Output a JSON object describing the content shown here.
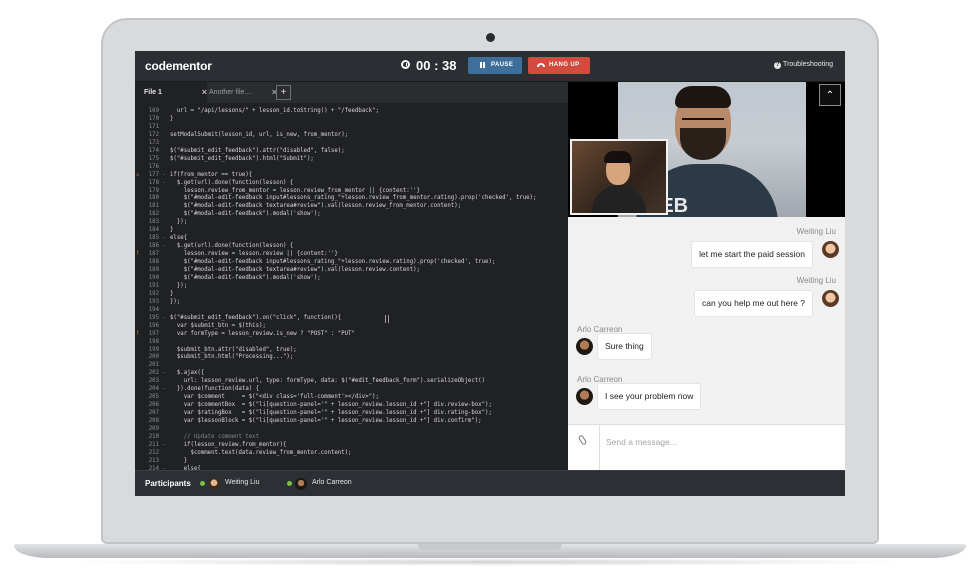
{
  "app": {
    "logo": "codementor",
    "timer": "00 : 38",
    "pause_label": "PAUSE",
    "hangup_label": "HANG UP",
    "troubleshooting_label": "Troubleshooting"
  },
  "tabs": [
    {
      "label": "File 1",
      "close": "×"
    },
    {
      "label": "Another file....",
      "close": "×"
    }
  ],
  "add_tab": "+",
  "editor": {
    "lines": [
      {
        "n": "169",
        "fold": "",
        "mark": "",
        "text": "  url = \"/api/lessons/\" + lesson_id.toString() + \"/feedback\";"
      },
      {
        "n": "170",
        "fold": "",
        "mark": "",
        "text": "}"
      },
      {
        "n": "171",
        "fold": "",
        "mark": "",
        "text": ""
      },
      {
        "n": "172",
        "fold": "",
        "mark": "",
        "text": "setModalSubmit(lesson_id, url, is_new, from_mentor);"
      },
      {
        "n": "173",
        "fold": "",
        "mark": "",
        "text": ""
      },
      {
        "n": "174",
        "fold": "",
        "mark": "",
        "text": "$(\"#submit_edit_feedback\").attr(\"disabled\", false);"
      },
      {
        "n": "175",
        "fold": "",
        "mark": "",
        "text": "$(\"#submit_edit_feedback\").html(\"Submit\");"
      },
      {
        "n": "176",
        "fold": "",
        "mark": "",
        "text": ""
      },
      {
        "n": "177",
        "fold": "-",
        "mark": "⚠",
        "text": "if(from_mentor == true){"
      },
      {
        "n": "178",
        "fold": "-",
        "mark": "",
        "text": "  $.get(url).done(function(lesson) {"
      },
      {
        "n": "179",
        "fold": "",
        "mark": "",
        "text": "    lesson.review_from_mentor = lesson.review_from_mentor || {content:''}"
      },
      {
        "n": "180",
        "fold": "",
        "mark": "",
        "text": "    $(\"#modal-edit-feedback input#lessons_rating_\"+lesson.review_from_mentor.rating).prop('checked', true);"
      },
      {
        "n": "181",
        "fold": "",
        "mark": "",
        "text": "    $(\"#modal-edit-feedback textarea#review\").val(lesson.review_from_mentor.content);"
      },
      {
        "n": "182",
        "fold": "",
        "mark": "",
        "text": "    $(\"#modal-edit-feedback\").modal('show');"
      },
      {
        "n": "183",
        "fold": "",
        "mark": "",
        "text": "  });"
      },
      {
        "n": "184",
        "fold": "",
        "mark": "",
        "text": "}"
      },
      {
        "n": "185",
        "fold": "-",
        "mark": "",
        "text": "else{"
      },
      {
        "n": "186",
        "fold": "-",
        "mark": "",
        "text": "  $.get(url).done(function(lesson) {"
      },
      {
        "n": "187",
        "fold": "",
        "mark": "!",
        "text": "    lesson.review = lesson.review || {content:''}"
      },
      {
        "n": "188",
        "fold": "",
        "mark": "",
        "text": "    $(\"#modal-edit-feedback input#lessons_rating_\"+lesson.review.rating).prop('checked', true);"
      },
      {
        "n": "189",
        "fold": "",
        "mark": "",
        "text": "    $(\"#modal-edit-feedback textarea#review\").val(lesson.review.content);"
      },
      {
        "n": "190",
        "fold": "",
        "mark": "",
        "text": "    $(\"#modal-edit-feedback\").modal('show');"
      },
      {
        "n": "191",
        "fold": "",
        "mark": "",
        "text": "  });"
      },
      {
        "n": "192",
        "fold": "",
        "mark": "",
        "text": "}"
      },
      {
        "n": "193",
        "fold": "",
        "mark": "",
        "text": "});"
      },
      {
        "n": "194",
        "fold": "",
        "mark": "",
        "text": ""
      },
      {
        "n": "195",
        "fold": "-",
        "mark": "",
        "text": "$(\"#submit_edit_feedback\").on(\"click\", function(){"
      },
      {
        "n": "196",
        "fold": "",
        "mark": "",
        "text": "  var $submit_btn = $(this);"
      },
      {
        "n": "197",
        "fold": "",
        "mark": "!",
        "text": "  var formType = lesson_review.is_new ? \"POST\" : \"PUT\""
      },
      {
        "n": "198",
        "fold": "",
        "mark": "",
        "text": ""
      },
      {
        "n": "199",
        "fold": "",
        "mark": "",
        "text": "  $submit_btn.attr(\"disabled\", true);"
      },
      {
        "n": "200",
        "fold": "",
        "mark": "",
        "text": "  $submit_btn.html(\"Processing...\");"
      },
      {
        "n": "201",
        "fold": "",
        "mark": "",
        "text": ""
      },
      {
        "n": "202",
        "fold": "-",
        "mark": "",
        "text": "  $.ajax({"
      },
      {
        "n": "203",
        "fold": "",
        "mark": "",
        "text": "    url: lesson_review.url, type: formType, data: $(\"#edit_feedback_form\").serializeObject()"
      },
      {
        "n": "204",
        "fold": "-",
        "mark": "",
        "text": "  }).done(function(data) {"
      },
      {
        "n": "205",
        "fold": "",
        "mark": "",
        "text": "    var $comment     = $(\"<div class='full-comment'></div>\");"
      },
      {
        "n": "206",
        "fold": "",
        "mark": "",
        "text": "    var $commentBox  = $(\"li[question-panel='\" + lesson_review.lesson_id +\"] div.review-box\");"
      },
      {
        "n": "207",
        "fold": "",
        "mark": "",
        "text": "    var $ratingBox   = $(\"li[question-panel='\" + lesson_review.lesson_id +\"] div.rating-box\");"
      },
      {
        "n": "208",
        "fold": "",
        "mark": "",
        "text": "    var $lessonBlock = $(\"li[question-panel='\" + lesson_review.lesson_id +\"] div.confirm\");"
      },
      {
        "n": "209",
        "fold": "",
        "mark": "",
        "text": ""
      },
      {
        "n": "210",
        "fold": "",
        "mark": "",
        "text": "    // Update comment text",
        "comment": true
      },
      {
        "n": "211",
        "fold": "-",
        "mark": "",
        "text": "    if(lesson_review.from_mentor){"
      },
      {
        "n": "212",
        "fold": "",
        "mark": "",
        "text": "      $comment.text(data.review_from_mentor.content);"
      },
      {
        "n": "213",
        "fold": "",
        "mark": "",
        "text": "    }"
      },
      {
        "n": "214",
        "fold": "-",
        "mark": "",
        "text": "    else{"
      }
    ]
  },
  "participants": {
    "label": "Participants",
    "items": [
      {
        "name": "Weiting Liu",
        "online": true
      },
      {
        "name": "Arlo Carreon",
        "online": true
      }
    ]
  },
  "video": {
    "expand_icon": "⌃",
    "shirt_text": "VEB"
  },
  "chat": {
    "messages": [
      {
        "sender": "Weiting Liu",
        "text": "let me start the paid session",
        "side": "right"
      },
      {
        "sender": "Weiting Liu",
        "text": "can you help me out here ?",
        "side": "right"
      },
      {
        "sender": "Arlo Carreon",
        "text": "Sure thing",
        "side": "left"
      },
      {
        "sender": "Arlo Carreon",
        "text": "I see your problem now",
        "side": "left"
      }
    ],
    "placeholder": "Send a message..."
  },
  "colors": {
    "pause": "#3e6f9b",
    "hangup": "#d24b3f",
    "online": "#7bc043"
  }
}
